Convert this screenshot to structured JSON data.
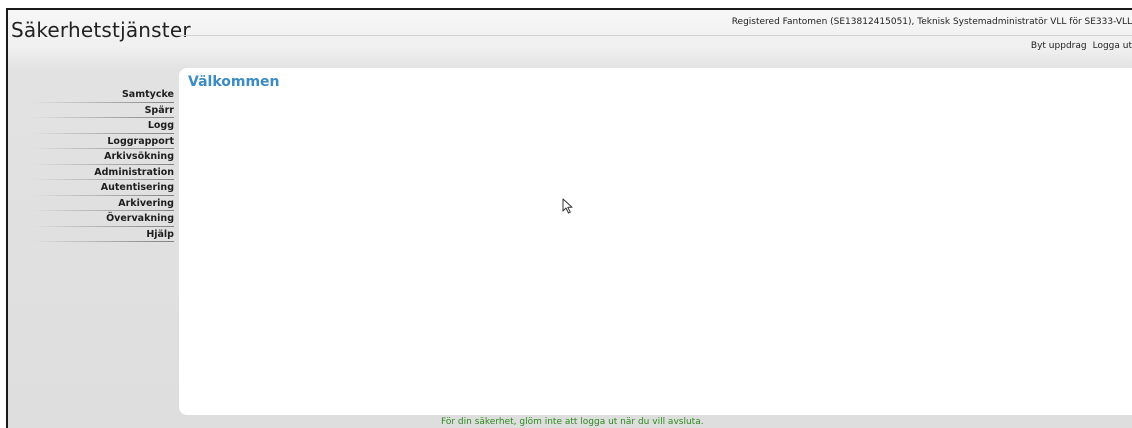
{
  "app": {
    "title": "Säkerhetstjänster"
  },
  "header": {
    "user_info": "Registered Fantomen (SE13812415051), Teknisk Systemadministratör VLL för SE333-VLL",
    "links": {
      "switch_assignment": "Byt uppdrag",
      "logout": "Logga ut"
    }
  },
  "sidebar": {
    "items": [
      {
        "label": "Samtycke"
      },
      {
        "label": "Spärr"
      },
      {
        "label": "Logg"
      },
      {
        "label": "Loggrapport"
      },
      {
        "label": "Arkivsökning"
      },
      {
        "label": "Administration"
      },
      {
        "label": "Autentisering"
      },
      {
        "label": "Arkivering"
      },
      {
        "label": "Övervakning"
      },
      {
        "label": "Hjälp"
      }
    ]
  },
  "main": {
    "title": "Välkommen"
  },
  "footer": {
    "message": "För din säkerhet, glöm inte att logga ut när du vill avsluta."
  },
  "colors": {
    "title_accent": "#3a8cc2",
    "footer_text": "#2c8a1c"
  }
}
